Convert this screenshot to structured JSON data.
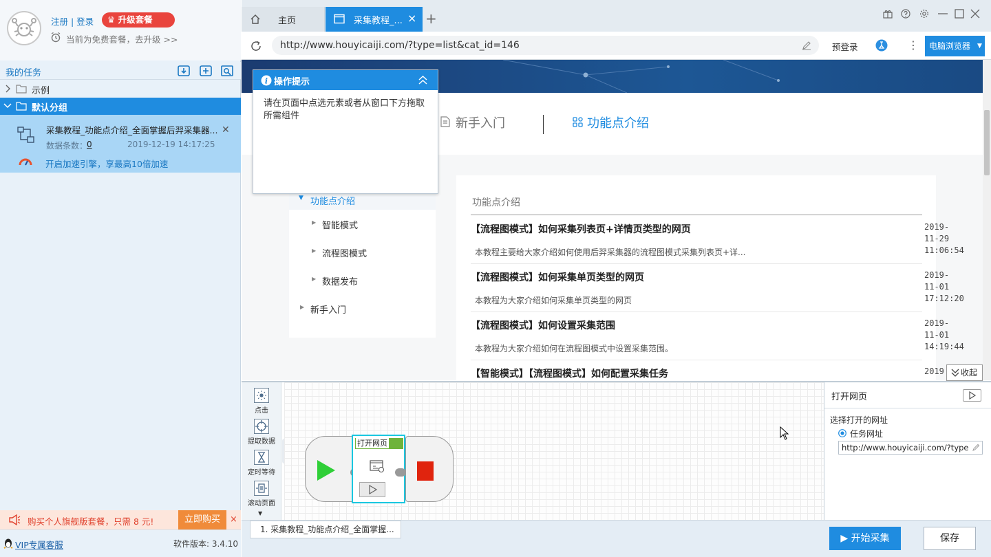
{
  "account": {
    "login_link": "注册 | 登录",
    "upgrade_label": "升级套餐",
    "plan_notice": "当前为免费套餐，去升级 >>"
  },
  "tasks": {
    "title": "我的任务",
    "groups": [
      {
        "label": "示例",
        "expanded": false
      },
      {
        "label": "默认分组",
        "expanded": true
      }
    ],
    "task": {
      "name": "采集教程_功能点介绍_全面掌握后羿采集器...",
      "count_label": "数据条数：",
      "count_value": "0",
      "timestamp": "2019-12-19 14:17:25",
      "boost_text": "开启加速引擎，享最高10倍加速"
    }
  },
  "promo": {
    "text": "购买个人旗舰版套餐，只需 8 元!",
    "buy_label": "立即购买",
    "close": "×"
  },
  "footer": {
    "vip_link": "VIP专属客服",
    "version": "软件版本: 3.4.10"
  },
  "browser": {
    "tabs": [
      {
        "label": "主页"
      },
      {
        "label": "采集教程_..."
      }
    ],
    "tab_close": "×",
    "new_tab": "+",
    "url": "http://www.houyicaiji.com/?type=list&cat_id=146",
    "prelogin": "预登录",
    "browser_mode": "电脑浏览器"
  },
  "web": {
    "nav": [
      {
        "label": "新手入门"
      },
      {
        "label": "功能点介绍"
      }
    ],
    "sidebar": {
      "active": "功能点介绍",
      "children": [
        "智能模式",
        "流程图模式",
        "数据发布"
      ],
      "other": "新手入门"
    },
    "section_title": "功能点介绍",
    "articles": [
      {
        "title": "【流程图模式】如何采集列表页+详情页类型的网页",
        "desc": "本教程主要给大家介绍如何使用后羿采集器的流程图模式采集列表页+详...",
        "date": [
          "2019-",
          "11-29",
          "11:06:54"
        ]
      },
      {
        "title": "【流程图模式】如何采集单页类型的网页",
        "desc": "本教程为大家介绍如何采集单页类型的网页",
        "date": [
          "2019-",
          "11-01",
          "17:12:20"
        ]
      },
      {
        "title": "【流程图模式】如何设置采集范围",
        "desc": "本教程为大家介绍如何在流程图模式中设置采集范围。",
        "date": [
          "2019-",
          "11-01",
          "14:19:44"
        ]
      },
      {
        "title": "【智能模式】【流程图模式】如何配置采集任务",
        "desc": "",
        "date": [
          "2019",
          "",
          ""
        ]
      }
    ],
    "collapse_label": "收起"
  },
  "tooltip": {
    "title": "操作提示",
    "body": "请在页面中点选元素或者从窗口下方拖取所需组件"
  },
  "flow": {
    "tools": [
      {
        "label": "点击",
        "icon": "click-icon"
      },
      {
        "label": "提取数据",
        "icon": "extract-icon"
      },
      {
        "label": "定时等待",
        "icon": "hourglass-icon"
      },
      {
        "label": "滚动页面",
        "icon": "scroll-icon"
      }
    ],
    "node_label": "打开网页",
    "task_tab": "1. 采集教程_功能点介绍_全面掌握..."
  },
  "props": {
    "title": "打开网页",
    "section": "选择打开的网址",
    "radio_label": "任务网址",
    "url_value": "http://www.houyicaiji.com/?type=li"
  },
  "actions": {
    "start": "开始采集",
    "save": "保存"
  },
  "colors": {
    "accent": "#1f8ce0",
    "upgrade": "#e9443d",
    "promo": "#f08b3a",
    "task_selected": "#a9d6f6"
  }
}
